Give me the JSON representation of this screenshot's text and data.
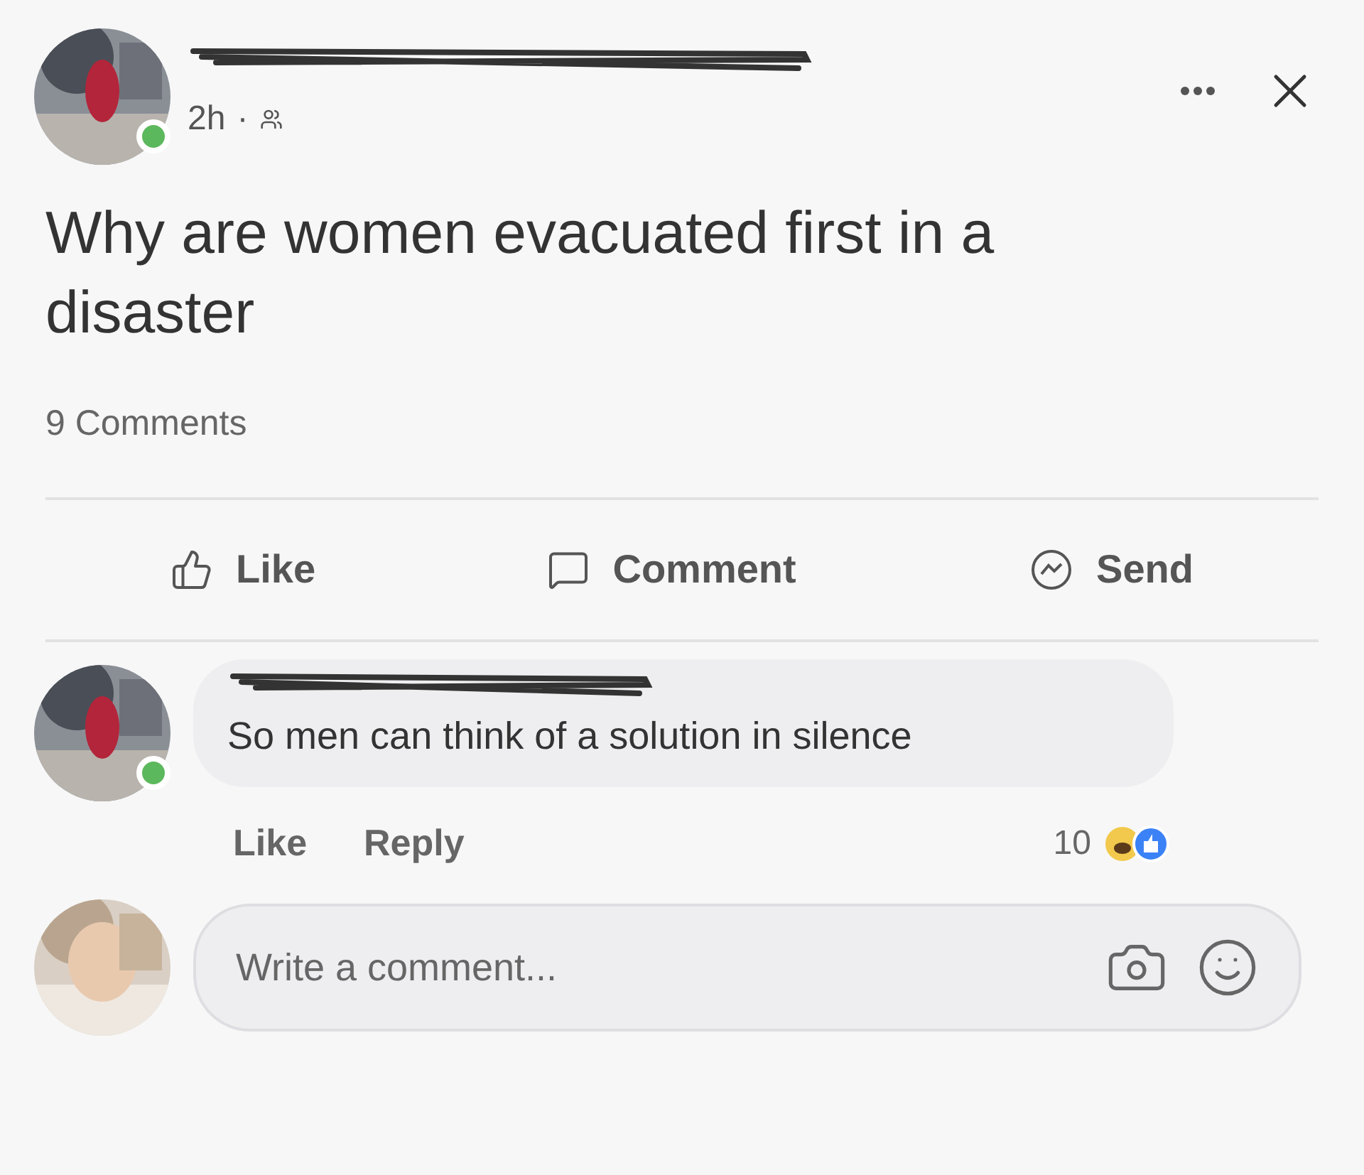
{
  "post": {
    "author_online": true,
    "time": "2h",
    "separator": "·",
    "text": "Why are women evacuated first in a disaster",
    "comment_count": "9 Comments"
  },
  "actions": [
    {
      "kind": "like",
      "label": "Like"
    },
    {
      "kind": "comment",
      "label": "Comment"
    },
    {
      "kind": "send",
      "label": "Send"
    }
  ],
  "comment": {
    "author_online": true,
    "text": "So men can think of a solution in silence",
    "actions": [
      "Like",
      "Reply"
    ],
    "reaction_count": "10"
  },
  "composer": {
    "placeholder": "Write a comment..."
  }
}
